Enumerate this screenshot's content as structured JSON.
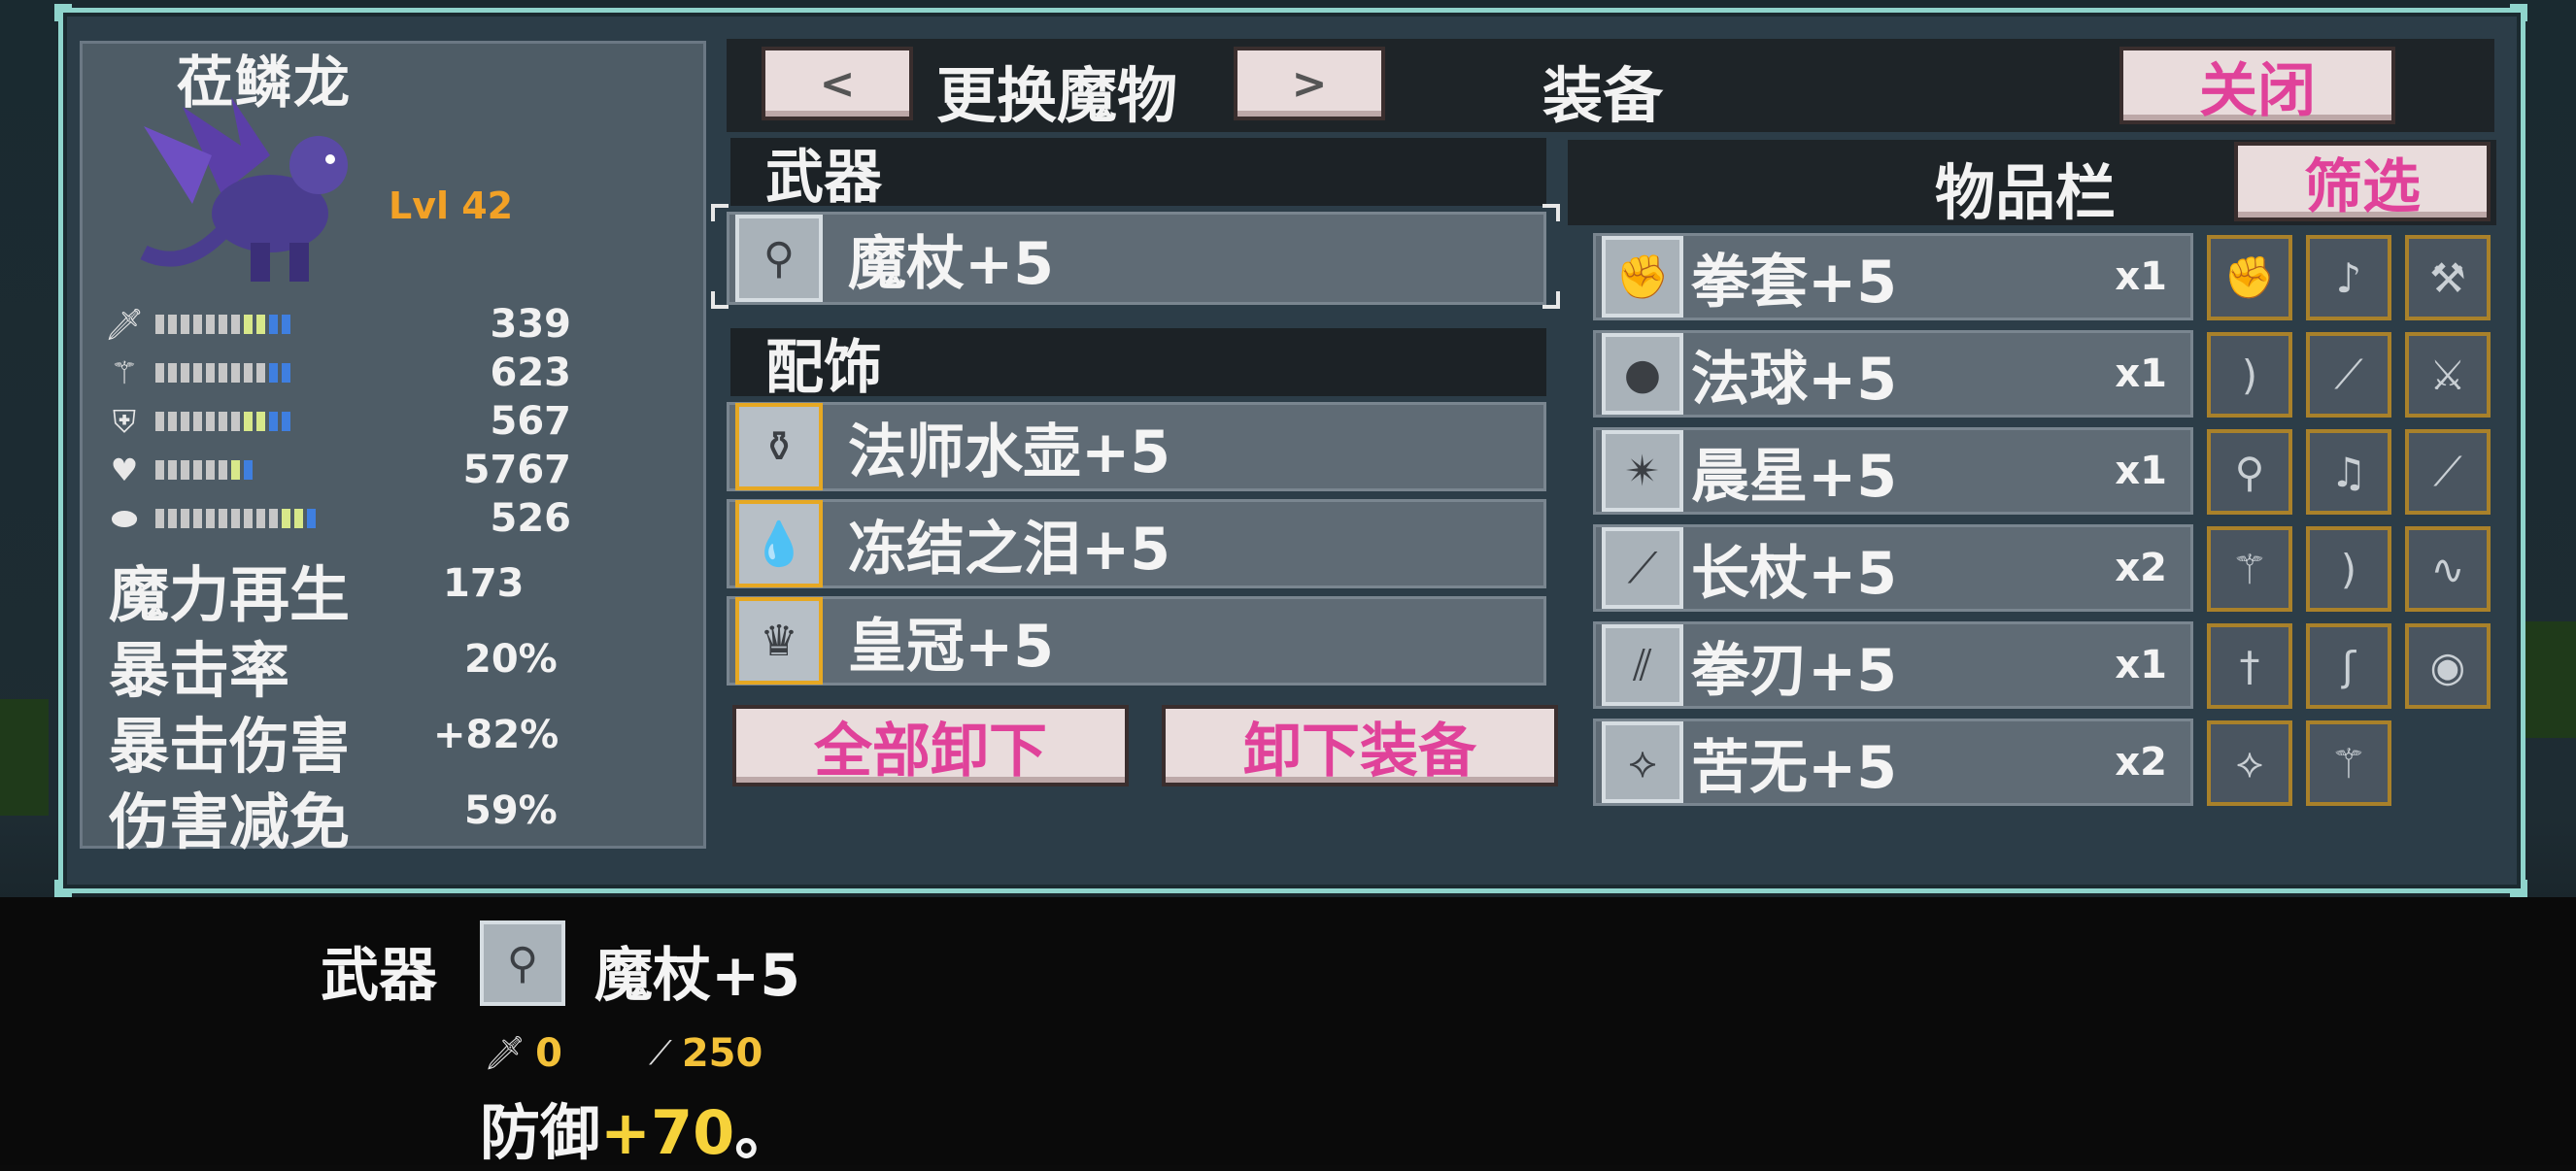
{
  "monster": {
    "name": "莅鳞龙",
    "level": "Lvl 42",
    "stats": [
      {
        "icon": "sword-icon",
        "value": "339"
      },
      {
        "icon": "staff-icon",
        "value": "623"
      },
      {
        "icon": "shield-icon",
        "value": "567"
      },
      {
        "icon": "heart-icon",
        "value": "5767"
      },
      {
        "icon": "mana-drop-icon",
        "value": "526"
      }
    ],
    "extra_stats": [
      {
        "label": "魔力再生",
        "value": "173"
      },
      {
        "label": "暴击率",
        "value": "20%"
      },
      {
        "label": "暴击伤害",
        "value": "+82%"
      },
      {
        "label": "伤害减免",
        "value": "59%"
      }
    ]
  },
  "header": {
    "prev_label": "<",
    "change_label": "更换魔物",
    "next_label": ">",
    "title": "装备",
    "close_label": "关闭"
  },
  "equipment": {
    "weapon_header": "武器",
    "weapon": {
      "icon": "wand-icon",
      "label": "魔杖+5"
    },
    "accessory_header": "配饰",
    "accessories": [
      {
        "icon": "potion-flask-icon",
        "label": "法师水壶+5"
      },
      {
        "icon": "ice-tear-icon",
        "label": "冻结之泪+5"
      },
      {
        "icon": "crown-icon",
        "label": "皇冠+5"
      }
    ],
    "unequip_all_label": "全部卸下",
    "unequip_label": "卸下装备"
  },
  "inventory": {
    "title": "物品栏",
    "filter_label": "筛选",
    "items": [
      {
        "icon": "gauntlet-icon",
        "label": "拳套+5",
        "qty": "x1"
      },
      {
        "icon": "orb-icon",
        "label": "法球+5",
        "qty": "x1"
      },
      {
        "icon": "morning-star-icon",
        "label": "晨星+5",
        "qty": "x1"
      },
      {
        "icon": "long-staff-icon",
        "label": "长杖+5",
        "qty": "x2"
      },
      {
        "icon": "fist-blade-icon",
        "label": "拳刃+5",
        "qty": "x1"
      },
      {
        "icon": "kunai-icon",
        "label": "苦无+5",
        "qty": "x2"
      }
    ],
    "grid_icons": [
      "gauntlet-icon",
      "lute-icon",
      "hammer-icon",
      "bow-icon",
      "blade-icon",
      "sword-icon",
      "mace-icon",
      "harp-icon",
      "scythe-icon",
      "trident-icon",
      "bow-icon",
      "whip-icon",
      "dagger-icon",
      "hook-icon",
      "shield-round-icon",
      "kunai-icon",
      "trident-icon"
    ]
  },
  "tooltip": {
    "label": "武器",
    "item_label": "魔杖+5",
    "icon": "wand-icon",
    "stat1": "0",
    "stat2": "250",
    "effect_prefix": "防御",
    "effect_value": "+70",
    "effect_suffix": "。"
  }
}
